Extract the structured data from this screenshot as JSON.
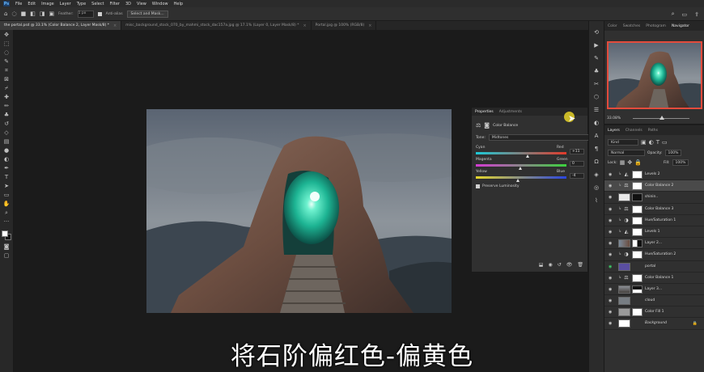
{
  "menubar": {
    "items": [
      "File",
      "Edit",
      "Image",
      "Layer",
      "Type",
      "Select",
      "Filter",
      "3D",
      "View",
      "Window",
      "Help"
    ]
  },
  "options": {
    "feather_label": "Feather:",
    "feather_value": "1 px",
    "antialias_label": "Anti-alias",
    "select_mask_label": "Select and Mask..."
  },
  "tabs": [
    {
      "label": "the portal.psd @ 33.1% (Color Balance 2, Layer Mask/8) *",
      "active": true
    },
    {
      "label": "misc_background_stock_070_by_mahmi_stock_dac157a.jpg @ 17.1% (Layer 0, Layer Mask/8) *",
      "active": false
    },
    {
      "label": "Portal.jpg @ 100% (RGB/8)",
      "active": false
    }
  ],
  "navigator": {
    "tabs": [
      "Color",
      "Swatches",
      "Photogram",
      "Navigator"
    ],
    "zoom": "33.08%"
  },
  "properties": {
    "tabs": [
      "Properties",
      "Adjustments"
    ],
    "title": "Color Balance",
    "tone_label": "Tone:",
    "tone_value": "Midtones",
    "sliders": [
      {
        "left": "Cyan",
        "right": "Red",
        "value": "+11"
      },
      {
        "left": "Magenta",
        "right": "Green",
        "value": "0"
      },
      {
        "left": "Yellow",
        "right": "Blue",
        "value": "-4"
      }
    ],
    "preserve_label": "Preserve Luminosity"
  },
  "layers": {
    "tabs": [
      "Layers",
      "Channels",
      "Paths"
    ],
    "kind_label": "Kind",
    "blend_mode": "Normal",
    "opacity_label": "Opacity:",
    "opacity_value": "100%",
    "lock_label": "Lock:",
    "fill_label": "Fill:",
    "fill_value": "100%",
    "items": [
      {
        "name": "Levels 2"
      },
      {
        "name": "Color Balance 2"
      },
      {
        "name": "shinin.."
      },
      {
        "name": "Color Balance 3"
      },
      {
        "name": "Hue/Saturation 1"
      },
      {
        "name": "Levels 1"
      },
      {
        "name": "Layer 2..."
      },
      {
        "name": "Hue/Saturation 2"
      },
      {
        "name": "portal"
      },
      {
        "name": "Color Balance 1"
      },
      {
        "name": "Layer 3..."
      },
      {
        "name": "cloud"
      },
      {
        "name": "Color Fill 1"
      },
      {
        "name": "Background"
      }
    ]
  },
  "subtitle": "将石阶偏红色-偏黄色"
}
